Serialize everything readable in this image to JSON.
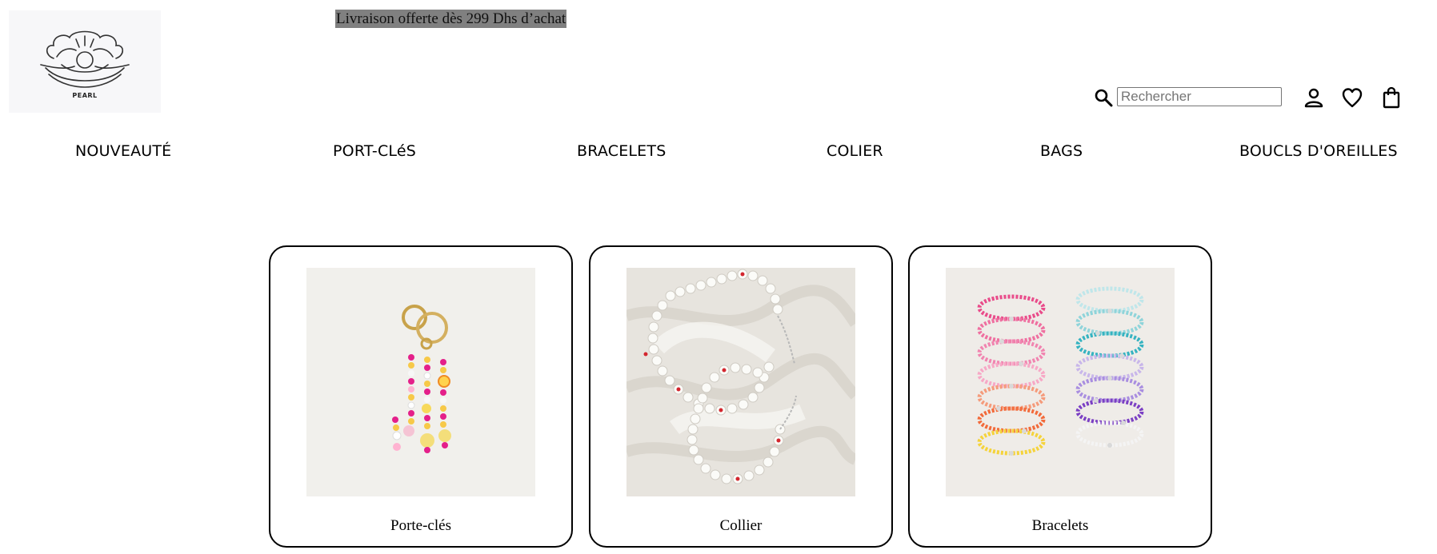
{
  "header": {
    "logo_text": "PEARL",
    "promo_text": "Livraison offerte dès 299 Dhs d’achat",
    "search": {
      "placeholder": "Rechercher",
      "value": ""
    },
    "icons": [
      "search-icon",
      "account-icon",
      "heart-icon",
      "shopping-bag-icon"
    ]
  },
  "nav": {
    "items": [
      {
        "label": "NOUVEAUTÉ"
      },
      {
        "label": "PORT-CLéS"
      },
      {
        "label": "BRACELETS"
      },
      {
        "label": "COLIER"
      },
      {
        "label": "BAGS"
      },
      {
        "label": "BOUCLS D'OREILLES"
      }
    ]
  },
  "categories": [
    {
      "label": "Porte-clés",
      "image": "keychain-photo"
    },
    {
      "label": "Collier",
      "image": "pearl-necklace-photo"
    },
    {
      "label": "Bracelets",
      "image": "beaded-bracelets-photo"
    }
  ],
  "colors": {
    "promo_bg": "#808080",
    "text": "#000000",
    "card_border": "#000000"
  }
}
